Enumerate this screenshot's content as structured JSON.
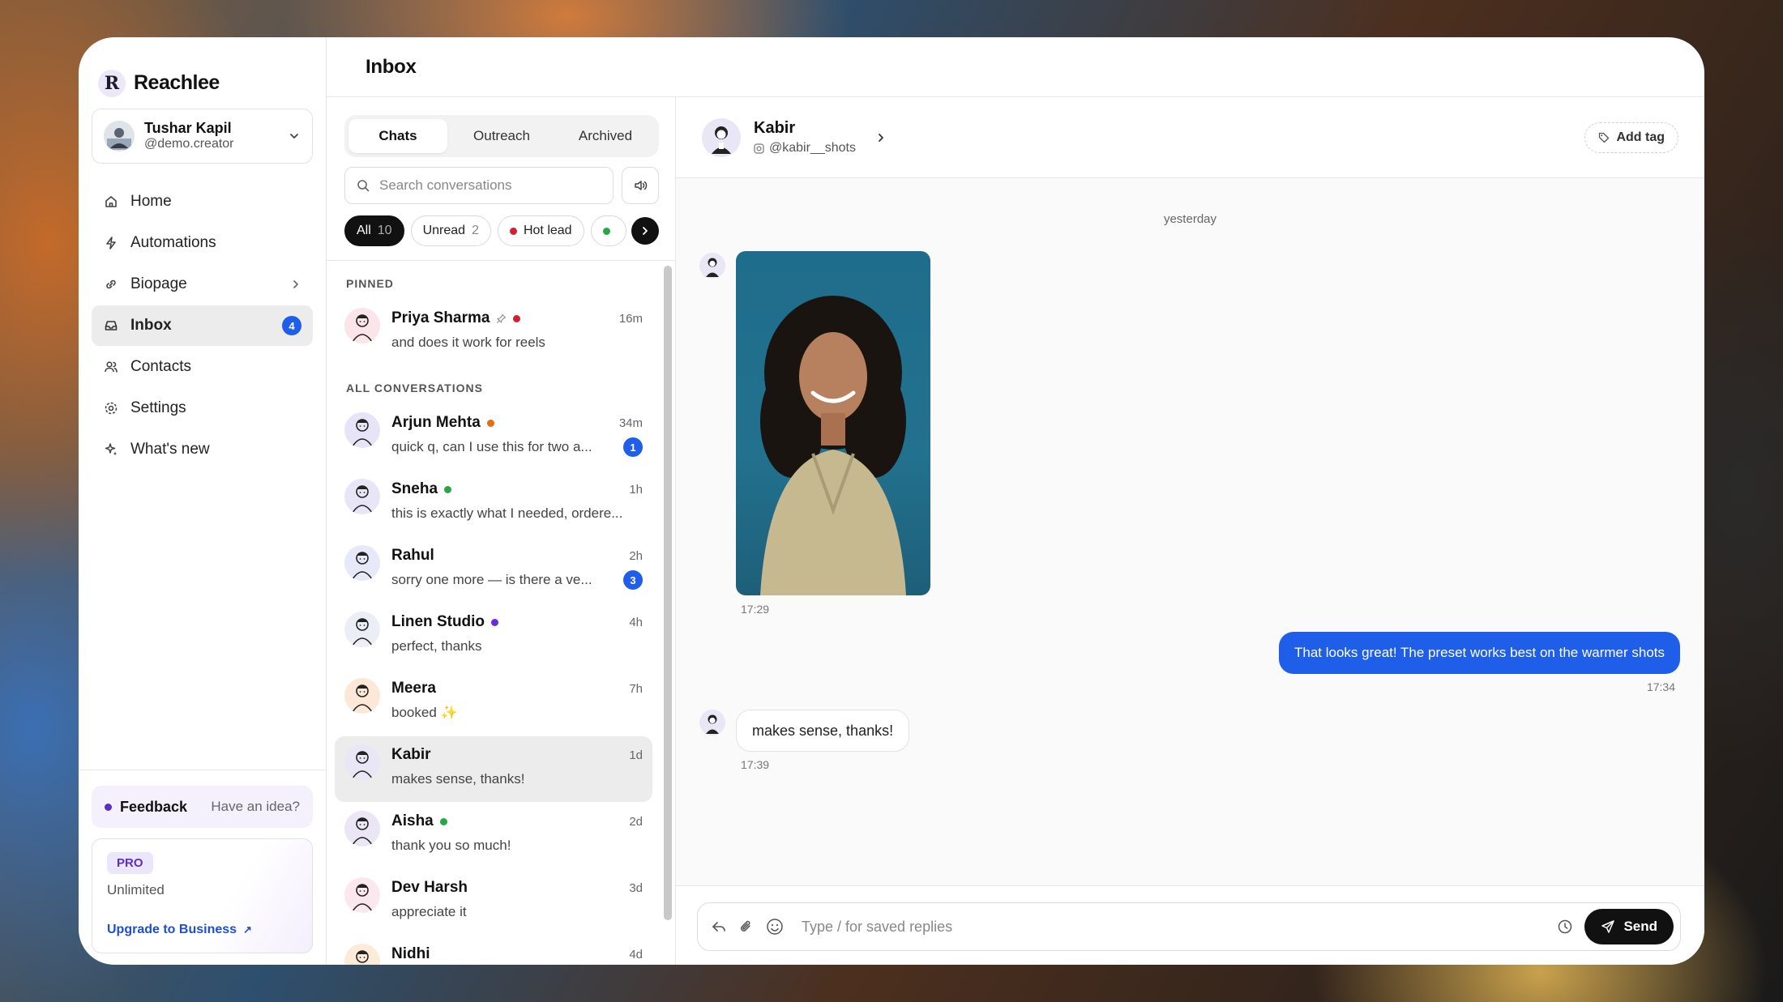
{
  "brand": {
    "logo_letter": "R",
    "name": "Reachlee"
  },
  "account": {
    "name": "Tushar Kapil",
    "handle": "@demo.creator"
  },
  "nav": [
    {
      "label": "Home",
      "icon": "home-icon"
    },
    {
      "label": "Automations",
      "icon": "bolt-icon"
    },
    {
      "label": "Biopage",
      "icon": "link-icon"
    },
    {
      "label": "Inbox",
      "icon": "inbox-icon",
      "badge": "4",
      "active": true
    },
    {
      "label": "Contacts",
      "icon": "users-icon"
    },
    {
      "label": "Settings",
      "icon": "gear-icon"
    },
    {
      "label": "What's new",
      "icon": "sparkle-icon"
    }
  ],
  "feedback": {
    "label": "Feedback",
    "hint": "Have an idea?"
  },
  "plan": {
    "badge": "PRO",
    "subtitle": "Unlimited",
    "upgrade": "Upgrade to Business",
    "upgrade_arrow": "↗"
  },
  "page": {
    "title": "Inbox"
  },
  "tabs": [
    {
      "label": "Chats",
      "active": true
    },
    {
      "label": "Outreach"
    },
    {
      "label": "Archived"
    }
  ],
  "search": {
    "placeholder": "Search conversations"
  },
  "filters": [
    {
      "label": "All",
      "count": "10"
    },
    {
      "label": "Unread",
      "count": "2"
    },
    {
      "label": "Hot lead"
    }
  ],
  "sections": {
    "pinned": "PINNED",
    "all": "ALL CONVERSATIONS"
  },
  "pinned": [
    {
      "name": "Priya Sharma",
      "time": "16m",
      "preview": "and does it work for reels",
      "pin": true,
      "dot": "#d2202f"
    }
  ],
  "conversations": [
    {
      "name": "Arjun Mehta",
      "time": "34m",
      "preview": "quick q, can I use this for two a...",
      "dot": "#ea6b12",
      "unread": "1"
    },
    {
      "name": "Sneha",
      "time": "1h",
      "preview": "this is exactly what I needed, ordere...",
      "dot": "#28a745"
    },
    {
      "name": "Rahul",
      "time": "2h",
      "preview": "sorry one more — is there a ve...",
      "unread": "3"
    },
    {
      "name": "Linen Studio",
      "time": "4h",
      "preview": "perfect, thanks",
      "dot": "#6a2bd9"
    },
    {
      "name": "Meera",
      "time": "7h",
      "preview": "booked ✨"
    },
    {
      "name": "Kabir",
      "time": "1d",
      "preview": "makes sense, thanks!",
      "active": true
    },
    {
      "name": "Aisha",
      "time": "2d",
      "preview": "thank you so much!",
      "dot": "#28a745"
    },
    {
      "name": "Dev Harsh",
      "time": "3d",
      "preview": "appreciate it"
    },
    {
      "name": "Nidhi",
      "time": "4d",
      "preview": ""
    }
  ],
  "chat": {
    "name": "Kabir",
    "handle": "@kabir__shots",
    "add_tag": "Add tag",
    "day": "yesterday",
    "photo_time": "17:29",
    "outgoing": {
      "text": "That looks great! The preset works best on the warmer shots",
      "time": "17:34"
    },
    "incoming": {
      "text": "makes sense, thanks!",
      "time": "17:39"
    }
  },
  "composer": {
    "placeholder": "Type / for saved replies",
    "send": "Send"
  },
  "colors": {
    "accent": "#1f5ee8",
    "dark": "#111111",
    "pro": "#5a2fc2"
  }
}
